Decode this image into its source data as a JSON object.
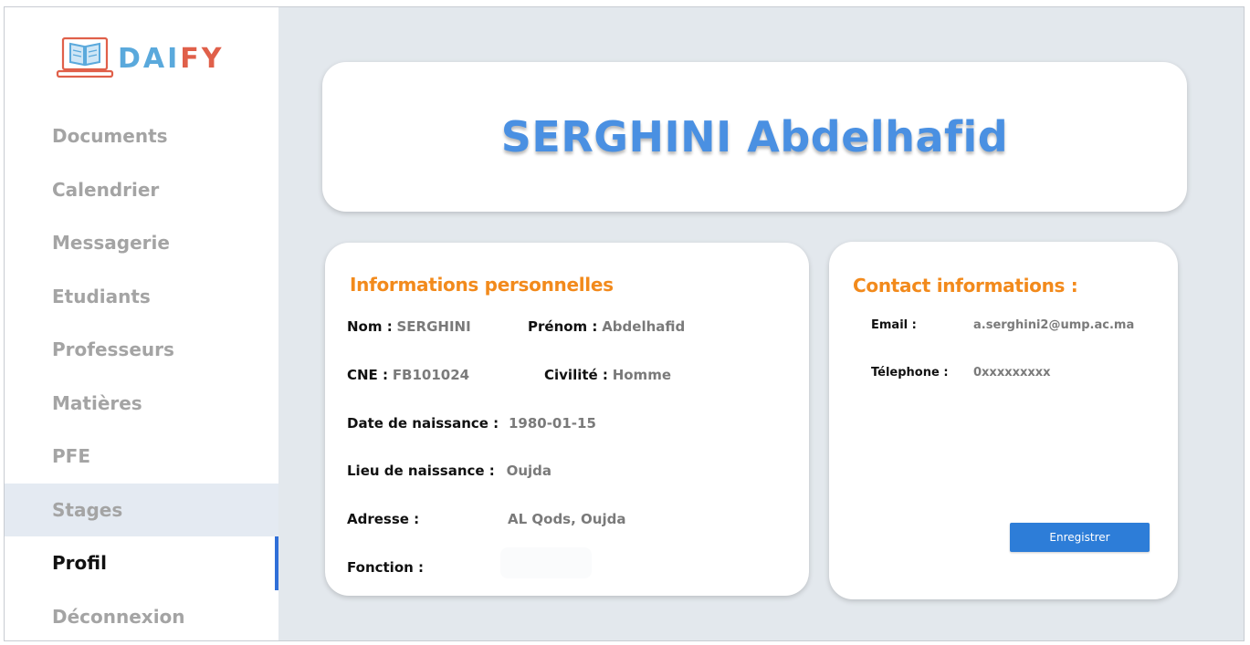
{
  "brand": {
    "name_part1": "DAI",
    "name_part2": "FY",
    "primary_color": "#5aa9dc",
    "accent_color": "#e0604a",
    "icon": "laptop-book-icon"
  },
  "sidebar": {
    "items": [
      {
        "label": "Documents",
        "state": "normal"
      },
      {
        "label": "Calendrier",
        "state": "normal"
      },
      {
        "label": "Messagerie",
        "state": "normal"
      },
      {
        "label": "Etudiants",
        "state": "normal"
      },
      {
        "label": "Professeurs",
        "state": "normal"
      },
      {
        "label": "Matières",
        "state": "normal"
      },
      {
        "label": "PFE",
        "state": "normal"
      },
      {
        "label": "Stages",
        "state": "hover"
      },
      {
        "label": "Profil",
        "state": "active"
      },
      {
        "label": "Déconnexion",
        "state": "normal"
      }
    ]
  },
  "profile": {
    "full_name": "SERGHINI Abdelhafid"
  },
  "personal": {
    "title": "Informations personnelles",
    "nom_label": "Nom :",
    "nom_value": "SERGHINI",
    "prenom_label": "Prénom :",
    "prenom_value": "Abdelhafid",
    "cne_label": "CNE :",
    "cne_value": "FB101024",
    "civilite_label": "Civilité :",
    "civilite_value": "Homme",
    "naissance_label": "Date de naissance :",
    "naissance_value": "1980-01-15",
    "lieu_label": "Lieu de naissance :",
    "lieu_value": "Oujda",
    "adresse_label": "Adresse :",
    "adresse_value": "AL Qods, Oujda",
    "fonction_label": "Fonction :",
    "fonction_value": ""
  },
  "contact": {
    "title": "Contact informations :",
    "email_label": "Email :",
    "email_value": "a.serghini2@ump.ac.ma",
    "tel_label": "Télephone :",
    "tel_value": "0xxxxxxxxx",
    "save_label": "Enregistrer",
    "button_color": "#2d7dd8"
  },
  "colors": {
    "background": "#e3e8ed",
    "section_title": "#f28a1c",
    "name_title": "#4a90e2",
    "active_indicator": "#2f6fd8"
  }
}
